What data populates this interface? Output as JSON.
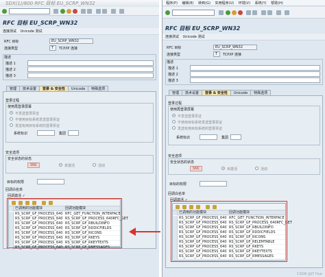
{
  "left": {
    "window_title": "SDX(1)/800 RFC 目标 EU_SCRP_WN32",
    "app_title": "RFC 目标 EU_SCRP_WN32",
    "app_buttons": [
      "连接测试",
      "Unicode 测试"
    ],
    "rfc_dest_label": "RFC 目标",
    "rfc_dest_value": "EU_SCRP_WN32",
    "conn_type_label": "连接类型",
    "conn_type_value": "T",
    "conn_type_desc": "TCP/IP 连接",
    "desc_group": "描述",
    "desc1": "描述 1",
    "desc2": "描述 2",
    "desc3": "描述 3",
    "tabs": [
      "管理",
      "技术设置",
      "登录 & 安全性",
      "Unicode",
      "特殊选项"
    ],
    "logon_group": "登录过程",
    "logon_screen": "使用再登录屏幕",
    "radio1": "不发送登录票证",
    "radio2": "不使用目标系统发送登录票证",
    "radio3": "发送有用目标系统的登录票证",
    "sysid_label": "系统标识",
    "client_label": "集团",
    "security_group": "安全选项",
    "security_status": "安全状态的状态",
    "snc_button": "SNC",
    "snc_inactive": "未激活",
    "snc_active": "活动",
    "auth_label": "目标的权限",
    "callback_group": "回调白名单",
    "callback_label": "回调激活 ✓",
    "alv_col1": "已调用的功能模块",
    "alv_col2": "回调功能模块",
    "rows": [
      [
        "RS_SCRP_GF_PROCESS_640",
        "RFC_GET_FUNCTION_INTERFACE"
      ],
      [
        "RS_SCRP_GF_PROCESS_640",
        "RS_SCRP_GF_PROCESS_640RFC_GET"
      ],
      [
        "RS_SCRP_GF_PROCESS_640",
        "RS_SCRP_GF_RBUILDINFO"
      ],
      [
        "RS_SCRP_GF_PROCESS_640",
        "RS_SCRP_GF_RDDICFIELDS"
      ],
      [
        "RS_SCRP_GF_PROCESS_640",
        "RS_SCRP_GF_RICONS"
      ],
      [
        "RS_SCRP_GF_PROCESS_640",
        "RS_SCRP_GF_RKEYS"
      ],
      [
        "RS_SCRP_GF_PROCESS_640",
        "RS_SCRP_GF_RKEYTEXTS"
      ],
      [
        "RS_SCRP_GF_PROCESS_640",
        "RS_SCRP_GF_RMESSAGES"
      ]
    ]
  },
  "right": {
    "menu": [
      "程序(P)",
      "编辑(E)",
      "转到(G)",
      "实用程序(U)",
      "环境(V)",
      "系统(Y)",
      "帮助(H)"
    ],
    "app_title": "RFC 目标 EU_SCRP_WN32",
    "app_buttons": [
      "连接测试",
      "Unicode 测试"
    ],
    "rfc_dest_label": "RFC 目标",
    "rfc_dest_value": "EU_SCRP_WN32",
    "conn_type_label": "连接类型",
    "conn_type_value": "T",
    "conn_type_desc": "TCP/IP 连接",
    "desc_group": "描述",
    "desc1": "描述 1",
    "desc2": "描述 2",
    "desc3": "描述 3",
    "tabs": [
      "管理",
      "技术设置",
      "登录 & 安全性",
      "Unicode",
      "特殊选项"
    ],
    "logon_group": "登录过程",
    "logon_screen": "使用再登录屏幕",
    "radio1": "不发送登录票证",
    "radio2": "不使用目标系统发送登录票证",
    "radio3": "发送有用目标系统的登录票证",
    "sysid_label": "系统标识",
    "client_label": "集团",
    "security_group": "安全选项",
    "security_status": "安全状态的状态",
    "snc_button": "SNC",
    "snc_inactive": "未激活",
    "snc_active": "活动",
    "auth_label": "目标的权限",
    "callback_group": "回调白名单",
    "callback_label": "回调激活 ✓",
    "alv_col1": "已调用的功能模块",
    "alv_col2": "回调功能模块",
    "rows": [
      [
        "RS_SCRP_GF_PROCESS_640",
        "RFC_GET_FUNCTION_INTERFACE"
      ],
      [
        "RS_SCRP_GF_PROCESS_640",
        "RS_SCRP_GF_PROCESS_640RFC_GET"
      ],
      [
        "RS_SCRP_GF_PROCESS_640",
        "RS_SCRP_GF_RBUILDINFO"
      ],
      [
        "RS_SCRP_GF_PROCESS_640",
        "RS_SCRP_GF_RDDICFIELDS"
      ],
      [
        "RS_SCRP_GF_PROCESS_640",
        "RS_SCRP_GF_RICONS"
      ],
      [
        "RS_SCRP_GF_PROCESS_640",
        "RS_SCRP_GF_RELEMTABLE"
      ],
      [
        "RS_SCRP_GF_PROCESS_640",
        "RS_SCRP_GF_RKEYS"
      ],
      [
        "RS_SCRP_GF_PROCESS_640",
        "RS_SCRP_GF_RKEYTEXTS"
      ],
      [
        "RS_SCRP_GF_PROCESS_640",
        "RS_SCRP_GF_RMESSAGES"
      ]
    ]
  },
  "watermark": "CSDN @IT Hue",
  "colors": {
    "highlight_box": "#d9342b",
    "arrow": "#d9342b",
    "active_tab": "#f7e6b3",
    "sap_bg": "#dfe8f0"
  }
}
